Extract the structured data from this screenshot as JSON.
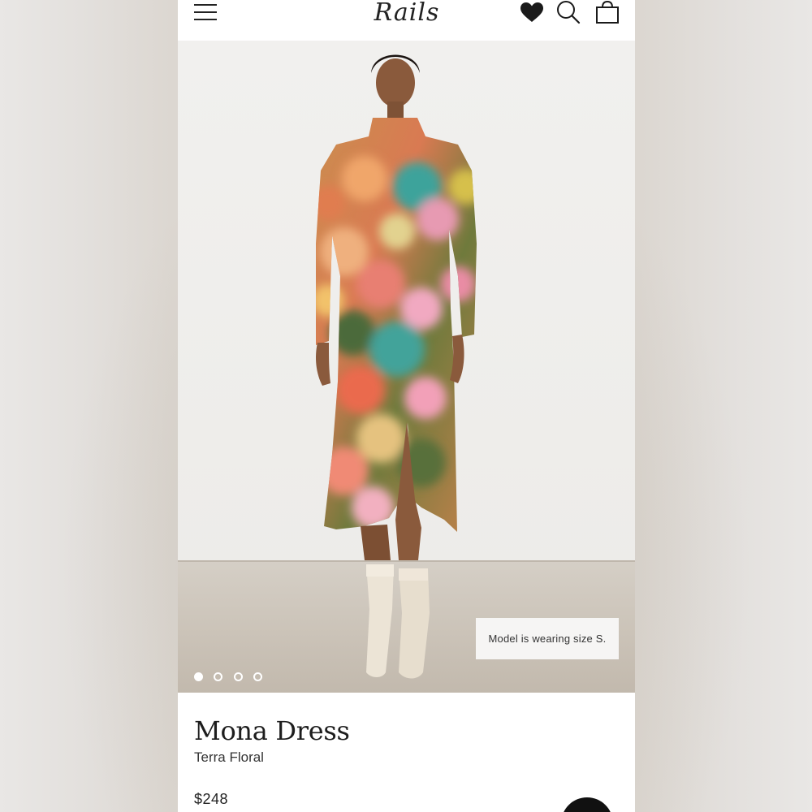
{
  "header": {
    "logo": "Rails",
    "icons": [
      "menu-icon",
      "heart-icon",
      "search-icon",
      "bag-icon"
    ]
  },
  "gallery": {
    "size_note": "Model is wearing size S.",
    "image_count": 4,
    "active_index": 0
  },
  "product": {
    "name": "Mona Dress",
    "color": "Terra Floral",
    "price": "$248"
  },
  "colors": {
    "text": "#1d1d1d",
    "fab": "#111111"
  }
}
